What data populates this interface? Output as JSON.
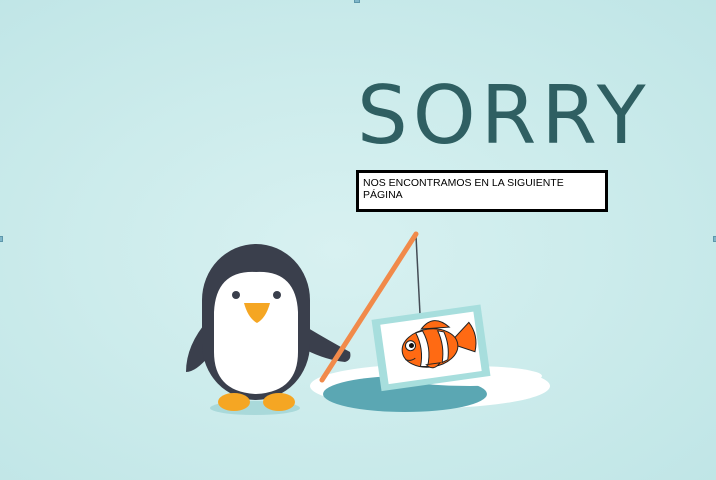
{
  "slide": {
    "title": "SORRY",
    "message": "NOS ENCONTRAMOS EN LA SIGUIENTE PÁGINA"
  },
  "illustration": {
    "character": "penguin",
    "activity": "ice-fishing",
    "catch_image": "clownfish-card"
  },
  "colors": {
    "background": "#cdecec",
    "title": "#2f5f62",
    "penguin_body": "#3a3f4c",
    "penguin_belly": "#ffffff",
    "beak_feet": "#f5a623",
    "fishing_rod": "#f18a4a",
    "ice": "#ffffff",
    "water": "#5ba7b3",
    "card_border": "#a7dedd",
    "fish_orange": "#ff6a13"
  }
}
